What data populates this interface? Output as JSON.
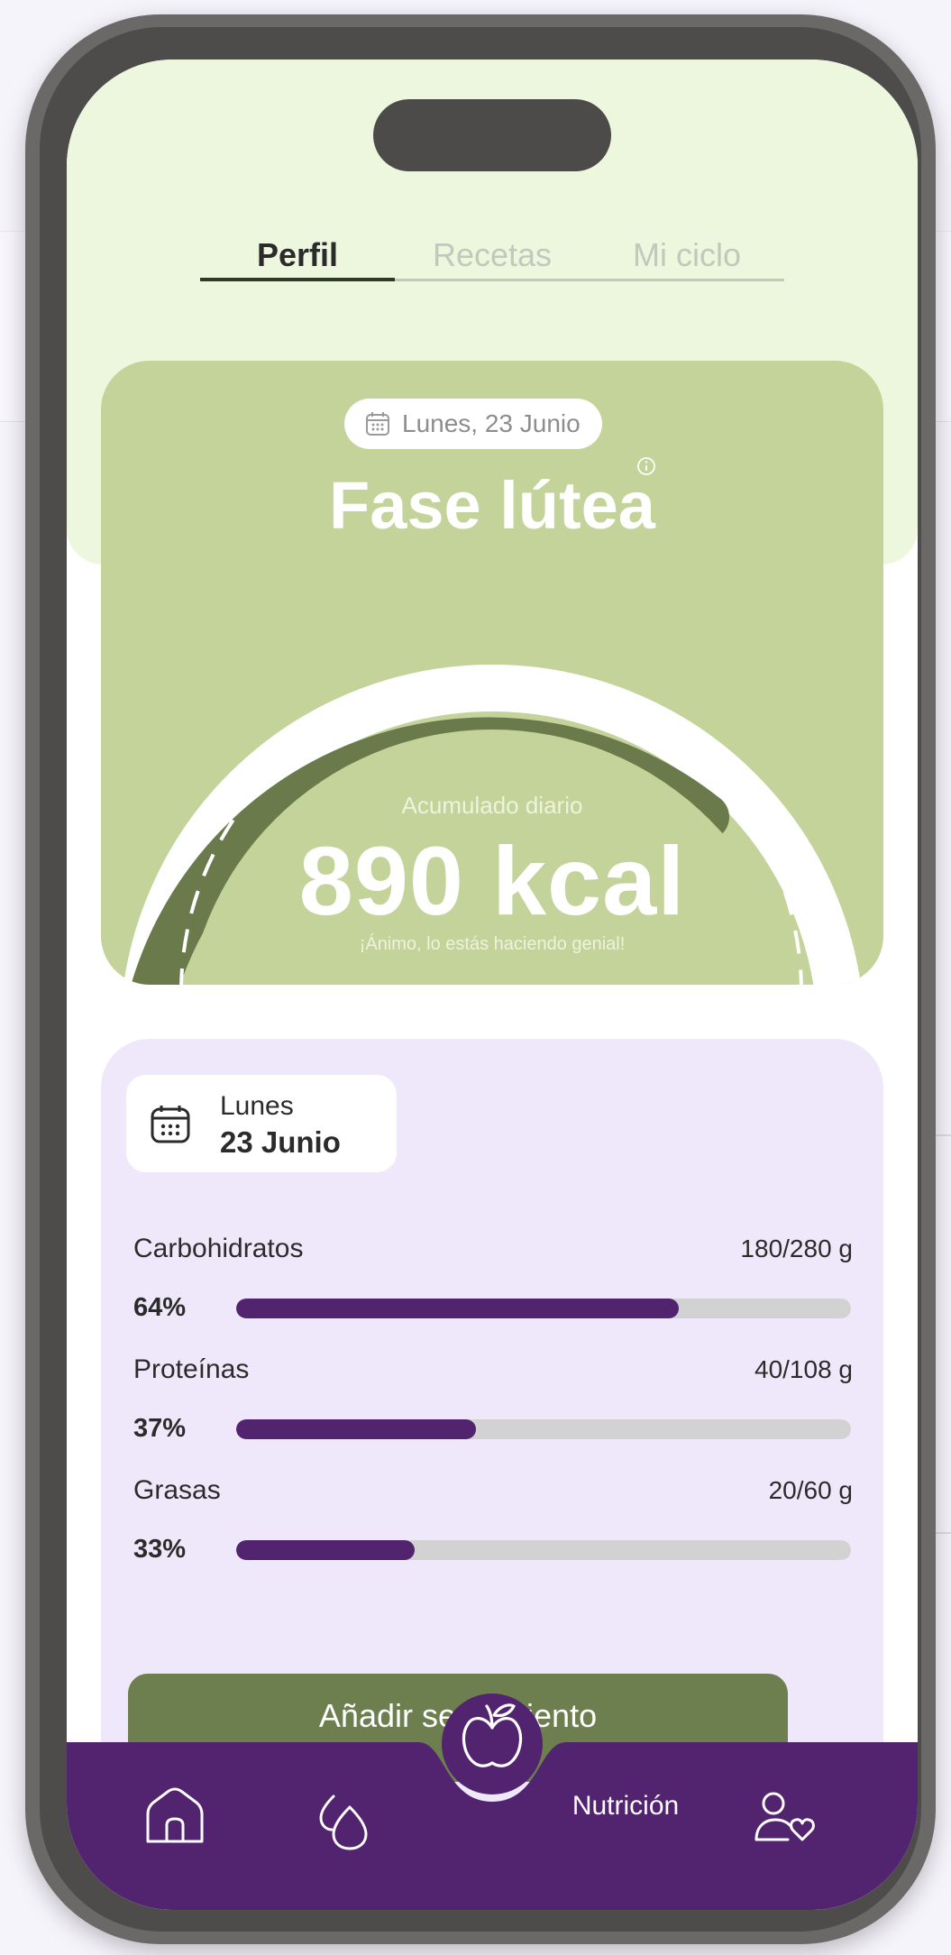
{
  "tabs": [
    {
      "label": "Perfil",
      "active": true
    },
    {
      "label": "Recetas",
      "active": false
    },
    {
      "label": "Mi ciclo",
      "active": false
    }
  ],
  "phase_card": {
    "date_pill": "Lunes, 23 Junio",
    "phase_title": "Fase lútea",
    "accumulated_label": "Acumulado diario",
    "kcal_value": "890 kcal",
    "encouragement": "¡Ánimo, lo estás haciendo genial!"
  },
  "macros_card": {
    "day": "Lunes",
    "date": "23 Junio",
    "items": [
      {
        "name": "Carbohidratos",
        "amount": "180/280 g",
        "percent_label": "64%",
        "progress": 0.72
      },
      {
        "name": "Proteínas",
        "amount": "40/108 g",
        "percent_label": "37%",
        "progress": 0.39
      },
      {
        "name": "Grasas",
        "amount": "20/60 g",
        "percent_label": "33%",
        "progress": 0.29
      }
    ],
    "add_button_label": "Añadir seguimiento"
  },
  "bottom_nav": {
    "items": [
      {
        "icon": "home-icon"
      },
      {
        "icon": "drops-icon"
      },
      {
        "icon": "apple-icon",
        "label": "Nutrición",
        "active": true
      },
      {
        "icon": "profile-heart-icon"
      }
    ]
  },
  "colors": {
    "phase_card": "#c3d39a",
    "arc_progress": "#6b7a4b",
    "macro_card": "#efe8fb",
    "progress_fill": "#52236f",
    "nav_bar": "#52236f",
    "button": "#6e7f4f"
  }
}
